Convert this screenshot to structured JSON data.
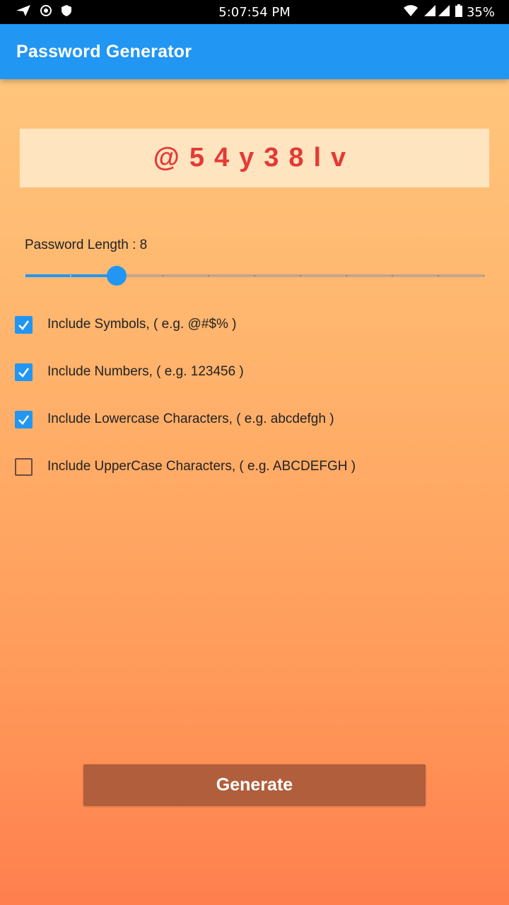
{
  "status_bar": {
    "time": "5:07:54 PM",
    "battery": "35%",
    "left_icons": [
      "send-icon",
      "target-icon",
      "shield-icon"
    ],
    "right_icons": [
      "wifi-icon",
      "signal-icon",
      "battery-icon"
    ]
  },
  "appbar": {
    "title": "Password Generator",
    "color": "#2196F3"
  },
  "password": {
    "value": "@54y38lv",
    "color": "#E53935"
  },
  "length": {
    "label": "Password Length : 8",
    "value": 8,
    "min": 6,
    "max": 16,
    "accent": "#2196F3"
  },
  "options": [
    {
      "label": "Include Symbols, ( e.g. @#$% )",
      "checked": true
    },
    {
      "label": "Include Numbers, ( e.g. 123456 )",
      "checked": true
    },
    {
      "label": "Include Lowercase Characters, ( e.g. abcdefgh )",
      "checked": true
    },
    {
      "label": "Include UpperCase Characters, ( e.g. ABCDEFGH )",
      "checked": false
    }
  ],
  "generate_button": {
    "label": "Generate",
    "color": "#B05E3C"
  }
}
